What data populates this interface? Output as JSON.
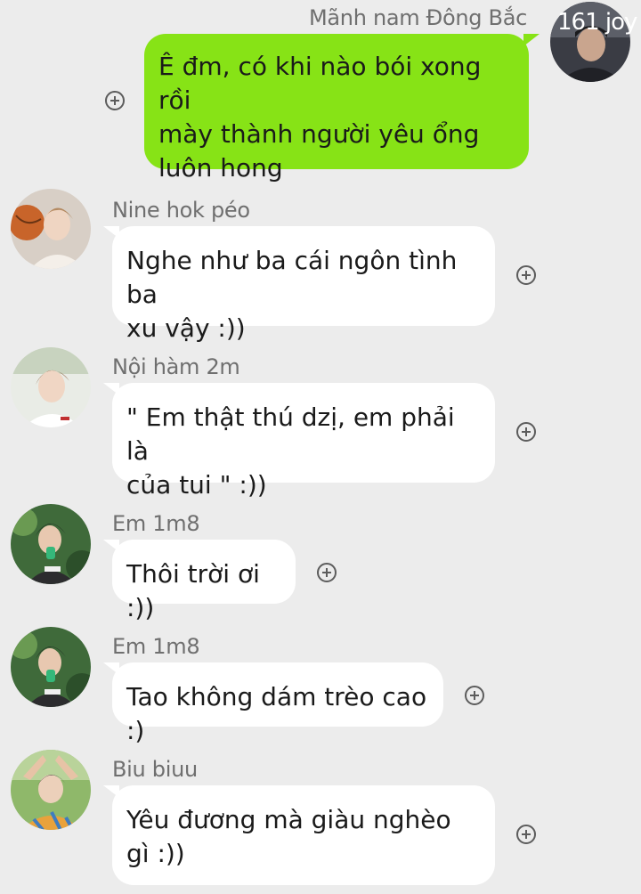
{
  "messages": [
    {
      "id": "m1",
      "direction": "out",
      "sender": "Mãnh nam Đông Bắc",
      "avatar_overlay": "161 joy",
      "text": "Ê đm, có khi nào bói xong rồi\nmày thành người yêu ổng\nluôn hong"
    },
    {
      "id": "m2",
      "direction": "in",
      "sender": "Nine hok péo",
      "text": "Nghe như ba cái ngôn tình ba\nxu vậy :))"
    },
    {
      "id": "m3",
      "direction": "in",
      "sender": "Nội hàm 2m",
      "text": "\" Em thật thú dzị, em phải là\ncủa tui \" :))"
    },
    {
      "id": "m4",
      "direction": "in",
      "sender": "Em 1m8",
      "text": "Thôi trời ơi :))"
    },
    {
      "id": "m5",
      "direction": "in",
      "sender": "Em 1m8",
      "text": "Tao không dám trèo cao :)"
    },
    {
      "id": "m6",
      "direction": "in",
      "sender": "Biu biuu",
      "text": "Yêu đương mà giàu nghèo\ngì :))"
    }
  ],
  "colors": {
    "background": "#ececec",
    "outgoing_bubble": "#87e316",
    "incoming_bubble": "#ffffff",
    "sender_text": "#6f6f6f"
  },
  "icons": {
    "reaction": "add-reaction-icon"
  }
}
